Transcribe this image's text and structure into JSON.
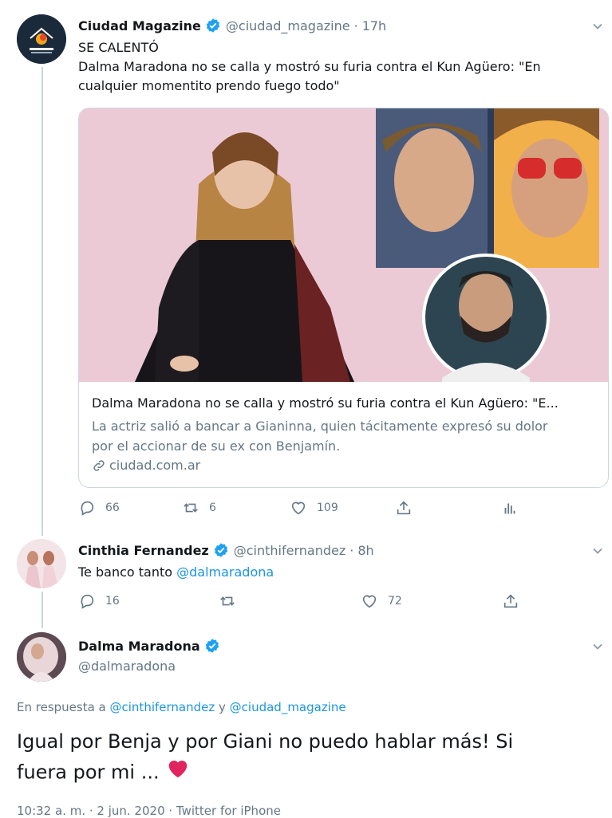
{
  "tweet1": {
    "name": "Ciudad Magazine",
    "handle": "@ciudad_magazine",
    "time": "17h",
    "line1": "SE CALENTÓ",
    "line2": "Dalma Maradona no se calla y mostró su furia contra el Kun Agüero: \"En",
    "line3": "cualquier momentito prendo fuego todo\"",
    "card": {
      "title": "Dalma Maradona no se calla y mostró su furia contra el Kun Agüero: \"E...",
      "desc1": "La actriz salió a bancar a Gianinna, quien tácitamente expresó su dolor",
      "desc2": "por el accionar de su ex con Benjamín.",
      "domain": "ciudad.com.ar"
    },
    "replies": "66",
    "retweets": "6",
    "likes": "109"
  },
  "tweet2": {
    "name": "Cinthia Fernandez",
    "handle": "@cinthifernandez",
    "time": "8h",
    "text_prefix": "Te banco tanto ",
    "mention": "@dalmaradona",
    "replies": "16",
    "likes": "72"
  },
  "tweet3": {
    "name": "Dalma Maradona",
    "handle": "@dalmaradona",
    "reply_prefix": "En respuesta a ",
    "reply_user1": "@cinthifernandez",
    "reply_and": " y ",
    "reply_user2": "@ciudad_magazine",
    "text1": "Igual por Benja y por Giani no puedo hablar más! Si",
    "text2": "fuera por mi ...",
    "footer": "10:32 a. m. · 2 jun. 2020 · Twitter for iPhone"
  },
  "colors": {
    "accent": "#1b95e0",
    "secondary_text": "#657786",
    "like_heart": "#e0245e"
  },
  "icons": [
    "verified-icon",
    "chevron-down-icon",
    "reply-icon",
    "retweet-icon",
    "like-icon",
    "share-icon",
    "analytics-icon",
    "link-icon",
    "heart-emoji"
  ]
}
